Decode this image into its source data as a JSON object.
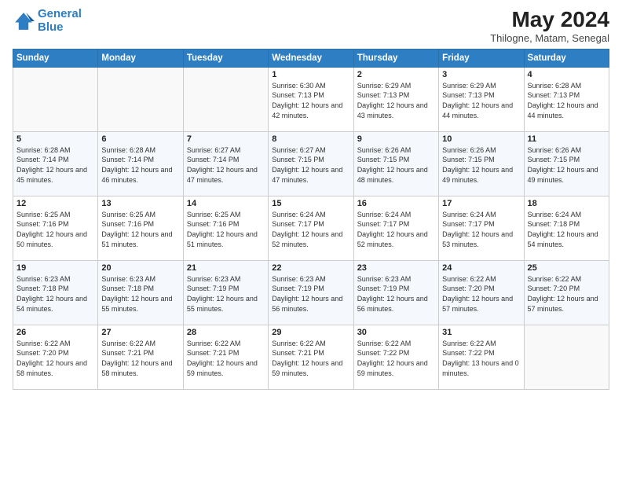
{
  "header": {
    "logo_line1": "General",
    "logo_line2": "Blue",
    "month_title": "May 2024",
    "location": "Thilogne, Matam, Senegal"
  },
  "days_of_week": [
    "Sunday",
    "Monday",
    "Tuesday",
    "Wednesday",
    "Thursday",
    "Friday",
    "Saturday"
  ],
  "weeks": [
    [
      {
        "day": "",
        "info": ""
      },
      {
        "day": "",
        "info": ""
      },
      {
        "day": "",
        "info": ""
      },
      {
        "day": "1",
        "info": "Sunrise: 6:30 AM\nSunset: 7:13 PM\nDaylight: 12 hours\nand 42 minutes."
      },
      {
        "day": "2",
        "info": "Sunrise: 6:29 AM\nSunset: 7:13 PM\nDaylight: 12 hours\nand 43 minutes."
      },
      {
        "day": "3",
        "info": "Sunrise: 6:29 AM\nSunset: 7:13 PM\nDaylight: 12 hours\nand 44 minutes."
      },
      {
        "day": "4",
        "info": "Sunrise: 6:28 AM\nSunset: 7:13 PM\nDaylight: 12 hours\nand 44 minutes."
      }
    ],
    [
      {
        "day": "5",
        "info": "Sunrise: 6:28 AM\nSunset: 7:14 PM\nDaylight: 12 hours\nand 45 minutes."
      },
      {
        "day": "6",
        "info": "Sunrise: 6:28 AM\nSunset: 7:14 PM\nDaylight: 12 hours\nand 46 minutes."
      },
      {
        "day": "7",
        "info": "Sunrise: 6:27 AM\nSunset: 7:14 PM\nDaylight: 12 hours\nand 47 minutes."
      },
      {
        "day": "8",
        "info": "Sunrise: 6:27 AM\nSunset: 7:15 PM\nDaylight: 12 hours\nand 47 minutes."
      },
      {
        "day": "9",
        "info": "Sunrise: 6:26 AM\nSunset: 7:15 PM\nDaylight: 12 hours\nand 48 minutes."
      },
      {
        "day": "10",
        "info": "Sunrise: 6:26 AM\nSunset: 7:15 PM\nDaylight: 12 hours\nand 49 minutes."
      },
      {
        "day": "11",
        "info": "Sunrise: 6:26 AM\nSunset: 7:15 PM\nDaylight: 12 hours\nand 49 minutes."
      }
    ],
    [
      {
        "day": "12",
        "info": "Sunrise: 6:25 AM\nSunset: 7:16 PM\nDaylight: 12 hours\nand 50 minutes."
      },
      {
        "day": "13",
        "info": "Sunrise: 6:25 AM\nSunset: 7:16 PM\nDaylight: 12 hours\nand 51 minutes."
      },
      {
        "day": "14",
        "info": "Sunrise: 6:25 AM\nSunset: 7:16 PM\nDaylight: 12 hours\nand 51 minutes."
      },
      {
        "day": "15",
        "info": "Sunrise: 6:24 AM\nSunset: 7:17 PM\nDaylight: 12 hours\nand 52 minutes."
      },
      {
        "day": "16",
        "info": "Sunrise: 6:24 AM\nSunset: 7:17 PM\nDaylight: 12 hours\nand 52 minutes."
      },
      {
        "day": "17",
        "info": "Sunrise: 6:24 AM\nSunset: 7:17 PM\nDaylight: 12 hours\nand 53 minutes."
      },
      {
        "day": "18",
        "info": "Sunrise: 6:24 AM\nSunset: 7:18 PM\nDaylight: 12 hours\nand 54 minutes."
      }
    ],
    [
      {
        "day": "19",
        "info": "Sunrise: 6:23 AM\nSunset: 7:18 PM\nDaylight: 12 hours\nand 54 minutes."
      },
      {
        "day": "20",
        "info": "Sunrise: 6:23 AM\nSunset: 7:18 PM\nDaylight: 12 hours\nand 55 minutes."
      },
      {
        "day": "21",
        "info": "Sunrise: 6:23 AM\nSunset: 7:19 PM\nDaylight: 12 hours\nand 55 minutes."
      },
      {
        "day": "22",
        "info": "Sunrise: 6:23 AM\nSunset: 7:19 PM\nDaylight: 12 hours\nand 56 minutes."
      },
      {
        "day": "23",
        "info": "Sunrise: 6:23 AM\nSunset: 7:19 PM\nDaylight: 12 hours\nand 56 minutes."
      },
      {
        "day": "24",
        "info": "Sunrise: 6:22 AM\nSunset: 7:20 PM\nDaylight: 12 hours\nand 57 minutes."
      },
      {
        "day": "25",
        "info": "Sunrise: 6:22 AM\nSunset: 7:20 PM\nDaylight: 12 hours\nand 57 minutes."
      }
    ],
    [
      {
        "day": "26",
        "info": "Sunrise: 6:22 AM\nSunset: 7:20 PM\nDaylight: 12 hours\nand 58 minutes."
      },
      {
        "day": "27",
        "info": "Sunrise: 6:22 AM\nSunset: 7:21 PM\nDaylight: 12 hours\nand 58 minutes."
      },
      {
        "day": "28",
        "info": "Sunrise: 6:22 AM\nSunset: 7:21 PM\nDaylight: 12 hours\nand 59 minutes."
      },
      {
        "day": "29",
        "info": "Sunrise: 6:22 AM\nSunset: 7:21 PM\nDaylight: 12 hours\nand 59 minutes."
      },
      {
        "day": "30",
        "info": "Sunrise: 6:22 AM\nSunset: 7:22 PM\nDaylight: 12 hours\nand 59 minutes."
      },
      {
        "day": "31",
        "info": "Sunrise: 6:22 AM\nSunset: 7:22 PM\nDaylight: 13 hours\nand 0 minutes."
      },
      {
        "day": "",
        "info": ""
      }
    ]
  ],
  "accent_color": "#2e7ec4"
}
